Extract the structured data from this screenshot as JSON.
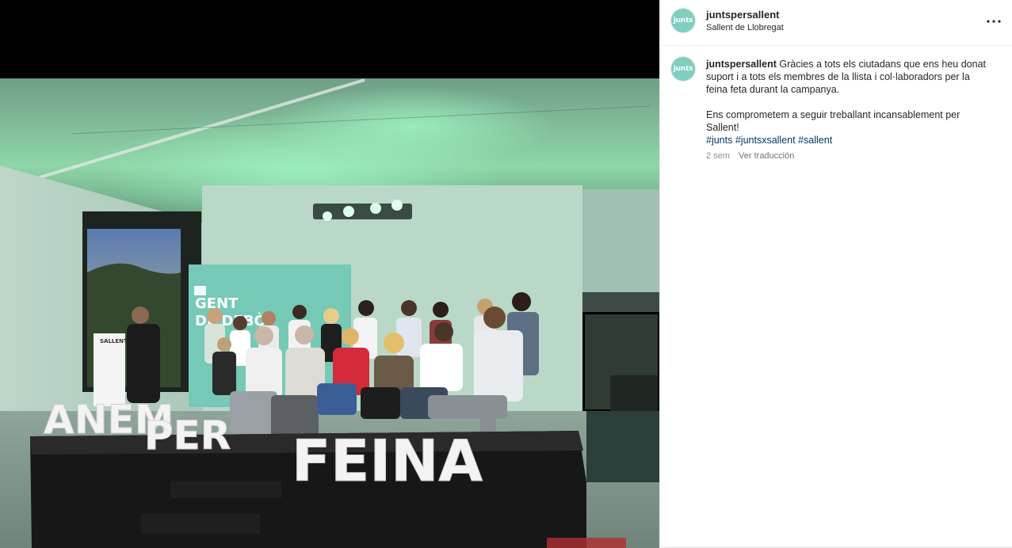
{
  "post": {
    "account": "juntspersallent",
    "avatar_text": "junts",
    "location": "Sallent de Llobregat",
    "caption": {
      "paragraph1": "Gràcies a tots els ciutadans que ens heu donat suport i a tots els membres de la llista i col·laboradors per la feina feta durant la campanya.",
      "paragraph2": "Ens comprometem a seguir treballant incansablement per Sallent!",
      "hashtags": [
        "#junts",
        "#juntsxsallent",
        "#sallent"
      ]
    },
    "time_ago": "2 sem",
    "translate_label": "Ver traducción"
  },
  "photo": {
    "banner_line1": "GENT",
    "banner_line2": "DE DEBÒ",
    "podium_label": "SALLENT",
    "letters_word1": "ANEM",
    "letters_word2": "PER",
    "letters_word3": "FEINA"
  },
  "colors": {
    "brand_teal": "#7fcfc0",
    "text": "#262626",
    "secondary": "#8e8e8e",
    "hashtag": "#00376b"
  },
  "icons": {
    "more": "more-horizontal-icon"
  }
}
